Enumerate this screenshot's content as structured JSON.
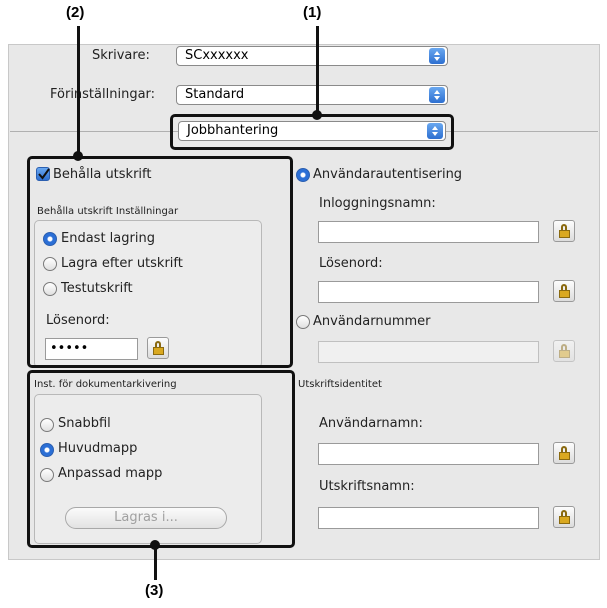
{
  "callouts": {
    "c1": "(1)",
    "c2": "(2)",
    "c3": "(3)"
  },
  "printer": {
    "label": "Skrivare:",
    "value": "SCxxxxxx"
  },
  "presets": {
    "label": "Förinställningar:",
    "value": "Standard"
  },
  "panel_menu": {
    "value": "Jobbhantering"
  },
  "retention": {
    "checkbox_label": "Behålla utskrift",
    "settings_title": "Behålla utskrift Inställningar",
    "options": [
      "Endast lagring",
      "Lagra efter utskrift",
      "Testutskrift"
    ],
    "selected": "Endast lagring",
    "password_label": "Lösenord:",
    "password_value": "•••••"
  },
  "filing": {
    "title": "Inst. för dokumentarkivering",
    "options": [
      "Snabbfil",
      "Huvudmapp",
      "Anpassad mapp"
    ],
    "selected": "Huvudmapp",
    "save_button": "Lagras i..."
  },
  "auth": {
    "user_auth_label": "Användarautentisering",
    "login_label": "Inloggningsnamn:",
    "password_label": "Lösenord:",
    "user_number_label": "Användarnummer"
  },
  "identity": {
    "title": "Utskriftsidentitet",
    "username_label": "Användarnamn:",
    "jobname_label": "Utskriftsnamn:"
  },
  "colors": {
    "accent": "#2d6fd0",
    "frame": "#111111",
    "panel": "#e8e8e8"
  }
}
